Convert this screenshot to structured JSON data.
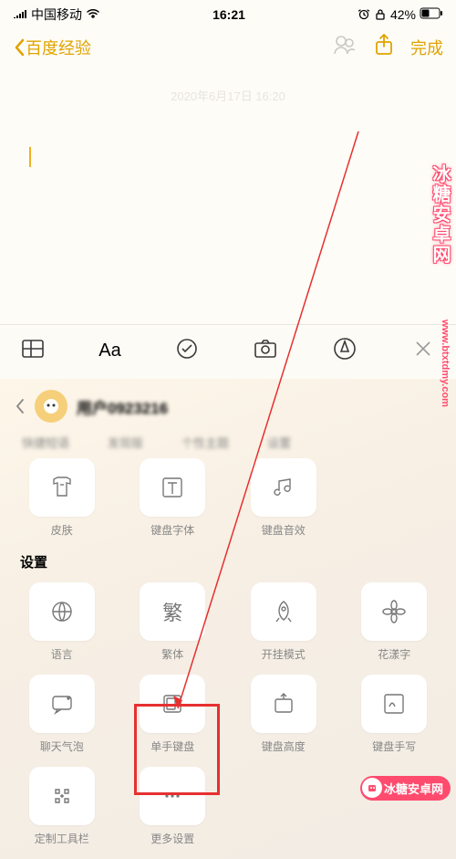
{
  "statusbar": {
    "carrier": "中国移动",
    "time": "16:21",
    "battery": "42%"
  },
  "nav": {
    "back": "百度经验",
    "done": "完成"
  },
  "note": {
    "date": "2020年6月17日 16:20"
  },
  "kb": {
    "username": "用户0923216",
    "tabs": [
      "快捷短语",
      "发现版",
      "个性主题",
      "设置"
    ],
    "row1": [
      {
        "label": "皮肤"
      },
      {
        "label": "键盘字体"
      },
      {
        "label": "键盘音效"
      }
    ],
    "section": "设置",
    "row2": [
      {
        "label": "语言"
      },
      {
        "label": "繁体"
      },
      {
        "label": "开挂模式"
      },
      {
        "label": "花漾字"
      }
    ],
    "row3": [
      {
        "label": "聊天气泡"
      },
      {
        "label": "单手键盘"
      },
      {
        "label": "键盘高度"
      },
      {
        "label": "键盘手写"
      }
    ],
    "row4": [
      {
        "label": "定制工具栏"
      },
      {
        "label": "更多设置"
      }
    ]
  },
  "watermark": {
    "brand": "冰糖安卓网",
    "domain": "www.btxtdmy.com"
  }
}
